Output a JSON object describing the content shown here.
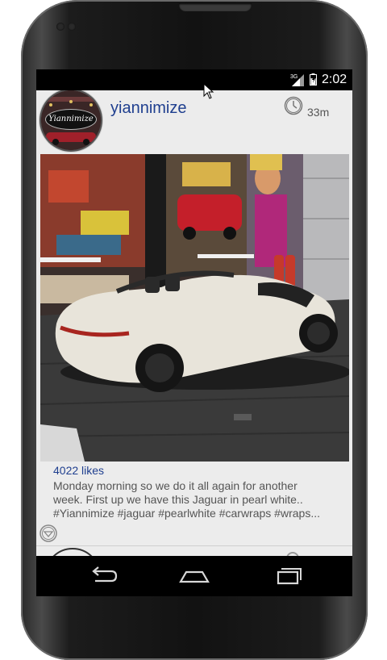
{
  "status_bar": {
    "network": "3G",
    "time": "2:02"
  },
  "post": {
    "avatar_logo_text": "Yiannimize",
    "username": "yiannimize",
    "time_ago": "33m",
    "photo_icon": "jaguar-convertible-photo",
    "likes": "4022 likes",
    "caption_line1": "Monday morning so we do it all again for another",
    "caption_line2": "week. First up we have this Jaguar in pearl white..",
    "caption_line3": "#Yiannimize #jaguar #pearlwhite #carwraps #wraps..."
  },
  "icons": {
    "clock": "clock-icon",
    "expand": "chevron-down-icon",
    "back": "back-icon",
    "home": "home-icon",
    "recents": "recents-icon"
  },
  "colors": {
    "accent": "#1f3f8f",
    "app_background": "#ececec",
    "text_secondary": "#555555"
  }
}
